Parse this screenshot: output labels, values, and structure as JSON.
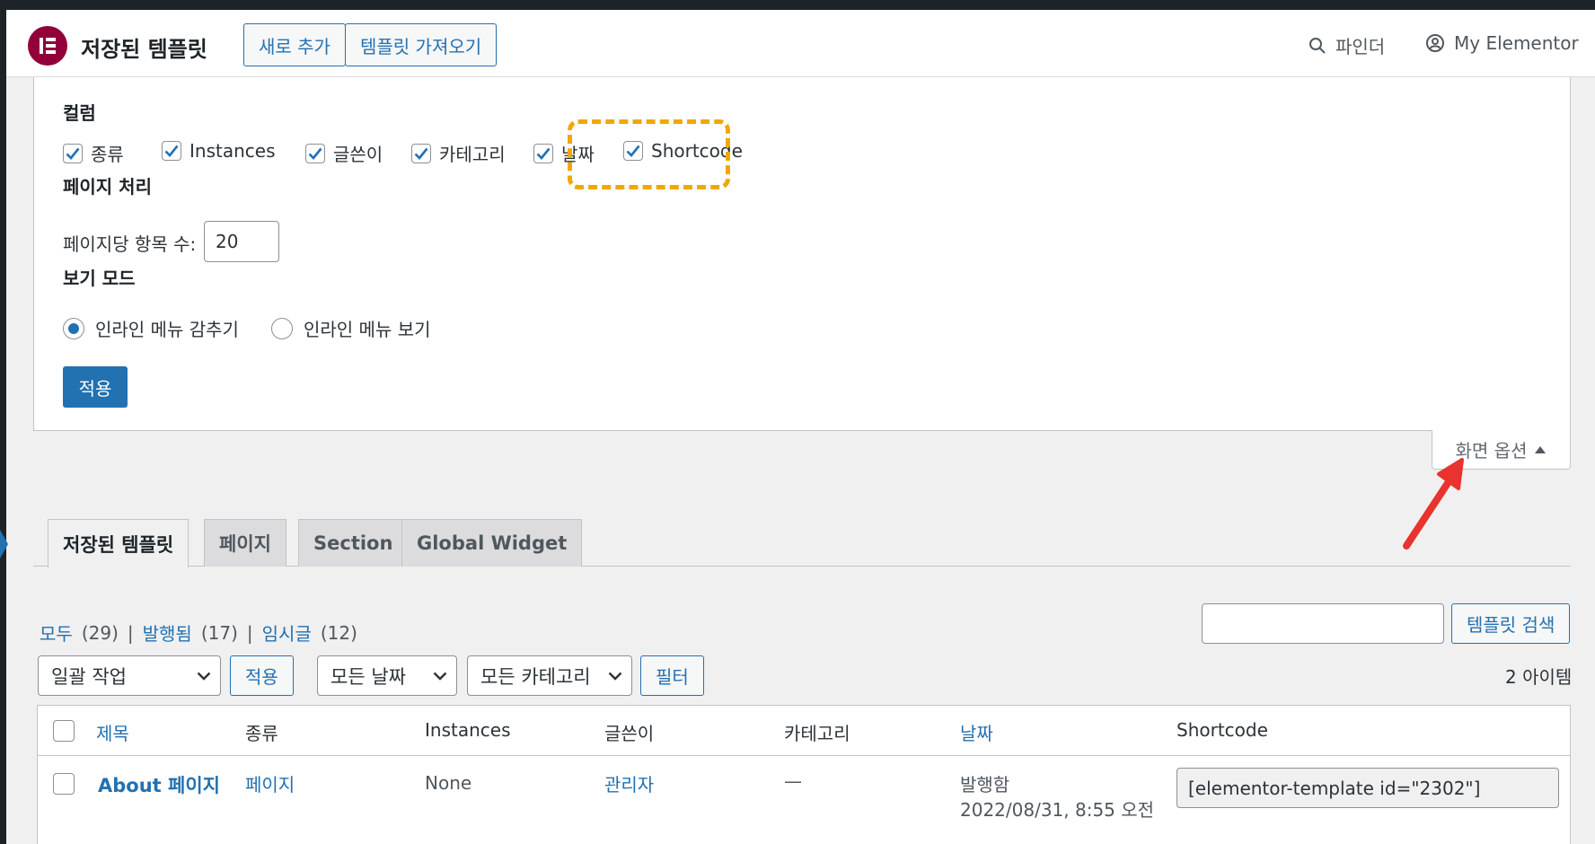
{
  "header": {
    "title": "저장된 템플릿",
    "add_new": "새로 추가",
    "import_templates": "템플릿 가져오기",
    "finder": "파인더",
    "my_elementor": "My Elementor"
  },
  "screen_options": {
    "columns_heading": "컬럼",
    "columns": [
      {
        "label": "종류",
        "checked": true
      },
      {
        "label": "Instances",
        "checked": true
      },
      {
        "label": "글쓴이",
        "checked": true
      },
      {
        "label": "카테고리",
        "checked": true
      },
      {
        "label": "날짜",
        "checked": true
      },
      {
        "label": "Shortcode",
        "checked": true
      }
    ],
    "pagination_heading": "페이지 처리",
    "per_page_label": "페이지당 항목 수:",
    "per_page_value": "20",
    "view_mode_heading": "보기 모드",
    "view_modes": [
      {
        "label": "인라인 메뉴 감추기",
        "selected": true
      },
      {
        "label": "인라인 메뉴 보기",
        "selected": false
      }
    ],
    "apply": "적용",
    "toggle_label": "화면 옵션"
  },
  "tabs": [
    {
      "label": "저장된 템플릿",
      "active": true
    },
    {
      "label": "페이지",
      "active": false
    },
    {
      "label": "Section",
      "active": false
    },
    {
      "label": "Global Widget",
      "active": false
    }
  ],
  "filters": {
    "all": "모두",
    "all_count": "(29)",
    "published": "발행됨",
    "published_count": "(17)",
    "draft": "임시글",
    "draft_count": "(12)",
    "search_button": "템플릿 검색",
    "bulk_action": "일괄 작업",
    "bulk_apply": "적용",
    "all_dates": "모든 날짜",
    "all_categories": "모든 카테고리",
    "filter_button": "필터",
    "items_count": "2 아이템"
  },
  "table": {
    "columns": [
      "제목",
      "종류",
      "Instances",
      "글쓴이",
      "카테고리",
      "날짜",
      "Shortcode"
    ],
    "rows": [
      {
        "title": "About 페이지",
        "type": "페이지",
        "instances": "None",
        "author": "관리자",
        "category": "—",
        "status": "발행함",
        "date": "2022/08/31, 8:55 오전",
        "shortcode": "[elementor-template id=\"2302\"]"
      }
    ]
  },
  "colors": {
    "accent": "#2271b1",
    "brand": "#92003b",
    "highlight": "#f0a800",
    "annotation_arrow": "#e8332e"
  }
}
